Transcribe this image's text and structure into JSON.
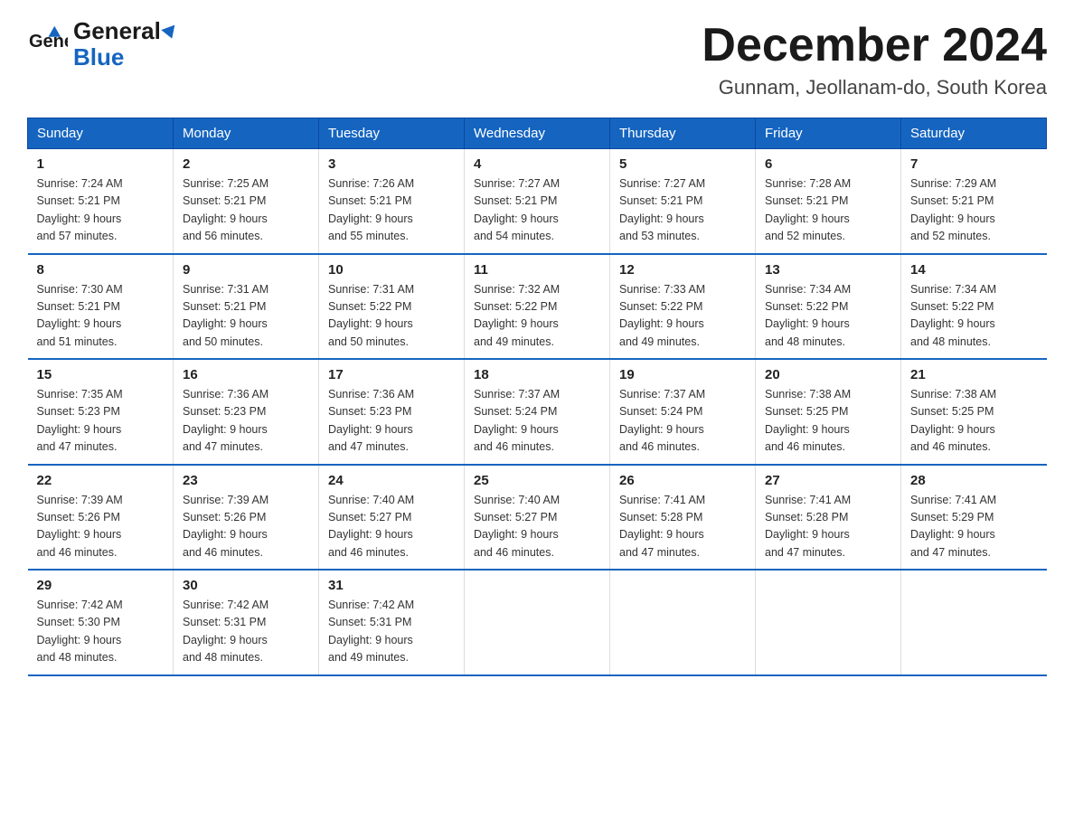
{
  "header": {
    "logo_general": "General",
    "logo_blue": "Blue",
    "month_title": "December 2024",
    "location": "Gunnam, Jeollanam-do, South Korea"
  },
  "weekdays": [
    "Sunday",
    "Monday",
    "Tuesday",
    "Wednesday",
    "Thursday",
    "Friday",
    "Saturday"
  ],
  "weeks": [
    [
      {
        "day": "1",
        "sunrise": "7:24 AM",
        "sunset": "5:21 PM",
        "daylight": "9 hours and 57 minutes."
      },
      {
        "day": "2",
        "sunrise": "7:25 AM",
        "sunset": "5:21 PM",
        "daylight": "9 hours and 56 minutes."
      },
      {
        "day": "3",
        "sunrise": "7:26 AM",
        "sunset": "5:21 PM",
        "daylight": "9 hours and 55 minutes."
      },
      {
        "day": "4",
        "sunrise": "7:27 AM",
        "sunset": "5:21 PM",
        "daylight": "9 hours and 54 minutes."
      },
      {
        "day": "5",
        "sunrise": "7:27 AM",
        "sunset": "5:21 PM",
        "daylight": "9 hours and 53 minutes."
      },
      {
        "day": "6",
        "sunrise": "7:28 AM",
        "sunset": "5:21 PM",
        "daylight": "9 hours and 52 minutes."
      },
      {
        "day": "7",
        "sunrise": "7:29 AM",
        "sunset": "5:21 PM",
        "daylight": "9 hours and 52 minutes."
      }
    ],
    [
      {
        "day": "8",
        "sunrise": "7:30 AM",
        "sunset": "5:21 PM",
        "daylight": "9 hours and 51 minutes."
      },
      {
        "day": "9",
        "sunrise": "7:31 AM",
        "sunset": "5:21 PM",
        "daylight": "9 hours and 50 minutes."
      },
      {
        "day": "10",
        "sunrise": "7:31 AM",
        "sunset": "5:22 PM",
        "daylight": "9 hours and 50 minutes."
      },
      {
        "day": "11",
        "sunrise": "7:32 AM",
        "sunset": "5:22 PM",
        "daylight": "9 hours and 49 minutes."
      },
      {
        "day": "12",
        "sunrise": "7:33 AM",
        "sunset": "5:22 PM",
        "daylight": "9 hours and 49 minutes."
      },
      {
        "day": "13",
        "sunrise": "7:34 AM",
        "sunset": "5:22 PM",
        "daylight": "9 hours and 48 minutes."
      },
      {
        "day": "14",
        "sunrise": "7:34 AM",
        "sunset": "5:22 PM",
        "daylight": "9 hours and 48 minutes."
      }
    ],
    [
      {
        "day": "15",
        "sunrise": "7:35 AM",
        "sunset": "5:23 PM",
        "daylight": "9 hours and 47 minutes."
      },
      {
        "day": "16",
        "sunrise": "7:36 AM",
        "sunset": "5:23 PM",
        "daylight": "9 hours and 47 minutes."
      },
      {
        "day": "17",
        "sunrise": "7:36 AM",
        "sunset": "5:23 PM",
        "daylight": "9 hours and 47 minutes."
      },
      {
        "day": "18",
        "sunrise": "7:37 AM",
        "sunset": "5:24 PM",
        "daylight": "9 hours and 46 minutes."
      },
      {
        "day": "19",
        "sunrise": "7:37 AM",
        "sunset": "5:24 PM",
        "daylight": "9 hours and 46 minutes."
      },
      {
        "day": "20",
        "sunrise": "7:38 AM",
        "sunset": "5:25 PM",
        "daylight": "9 hours and 46 minutes."
      },
      {
        "day": "21",
        "sunrise": "7:38 AM",
        "sunset": "5:25 PM",
        "daylight": "9 hours and 46 minutes."
      }
    ],
    [
      {
        "day": "22",
        "sunrise": "7:39 AM",
        "sunset": "5:26 PM",
        "daylight": "9 hours and 46 minutes."
      },
      {
        "day": "23",
        "sunrise": "7:39 AM",
        "sunset": "5:26 PM",
        "daylight": "9 hours and 46 minutes."
      },
      {
        "day": "24",
        "sunrise": "7:40 AM",
        "sunset": "5:27 PM",
        "daylight": "9 hours and 46 minutes."
      },
      {
        "day": "25",
        "sunrise": "7:40 AM",
        "sunset": "5:27 PM",
        "daylight": "9 hours and 46 minutes."
      },
      {
        "day": "26",
        "sunrise": "7:41 AM",
        "sunset": "5:28 PM",
        "daylight": "9 hours and 47 minutes."
      },
      {
        "day": "27",
        "sunrise": "7:41 AM",
        "sunset": "5:28 PM",
        "daylight": "9 hours and 47 minutes."
      },
      {
        "day": "28",
        "sunrise": "7:41 AM",
        "sunset": "5:29 PM",
        "daylight": "9 hours and 47 minutes."
      }
    ],
    [
      {
        "day": "29",
        "sunrise": "7:42 AM",
        "sunset": "5:30 PM",
        "daylight": "9 hours and 48 minutes."
      },
      {
        "day": "30",
        "sunrise": "7:42 AM",
        "sunset": "5:31 PM",
        "daylight": "9 hours and 48 minutes."
      },
      {
        "day": "31",
        "sunrise": "7:42 AM",
        "sunset": "5:31 PM",
        "daylight": "9 hours and 49 minutes."
      },
      null,
      null,
      null,
      null
    ]
  ],
  "labels": {
    "sunrise": "Sunrise: ",
    "sunset": "Sunset: ",
    "daylight": "Daylight: "
  }
}
